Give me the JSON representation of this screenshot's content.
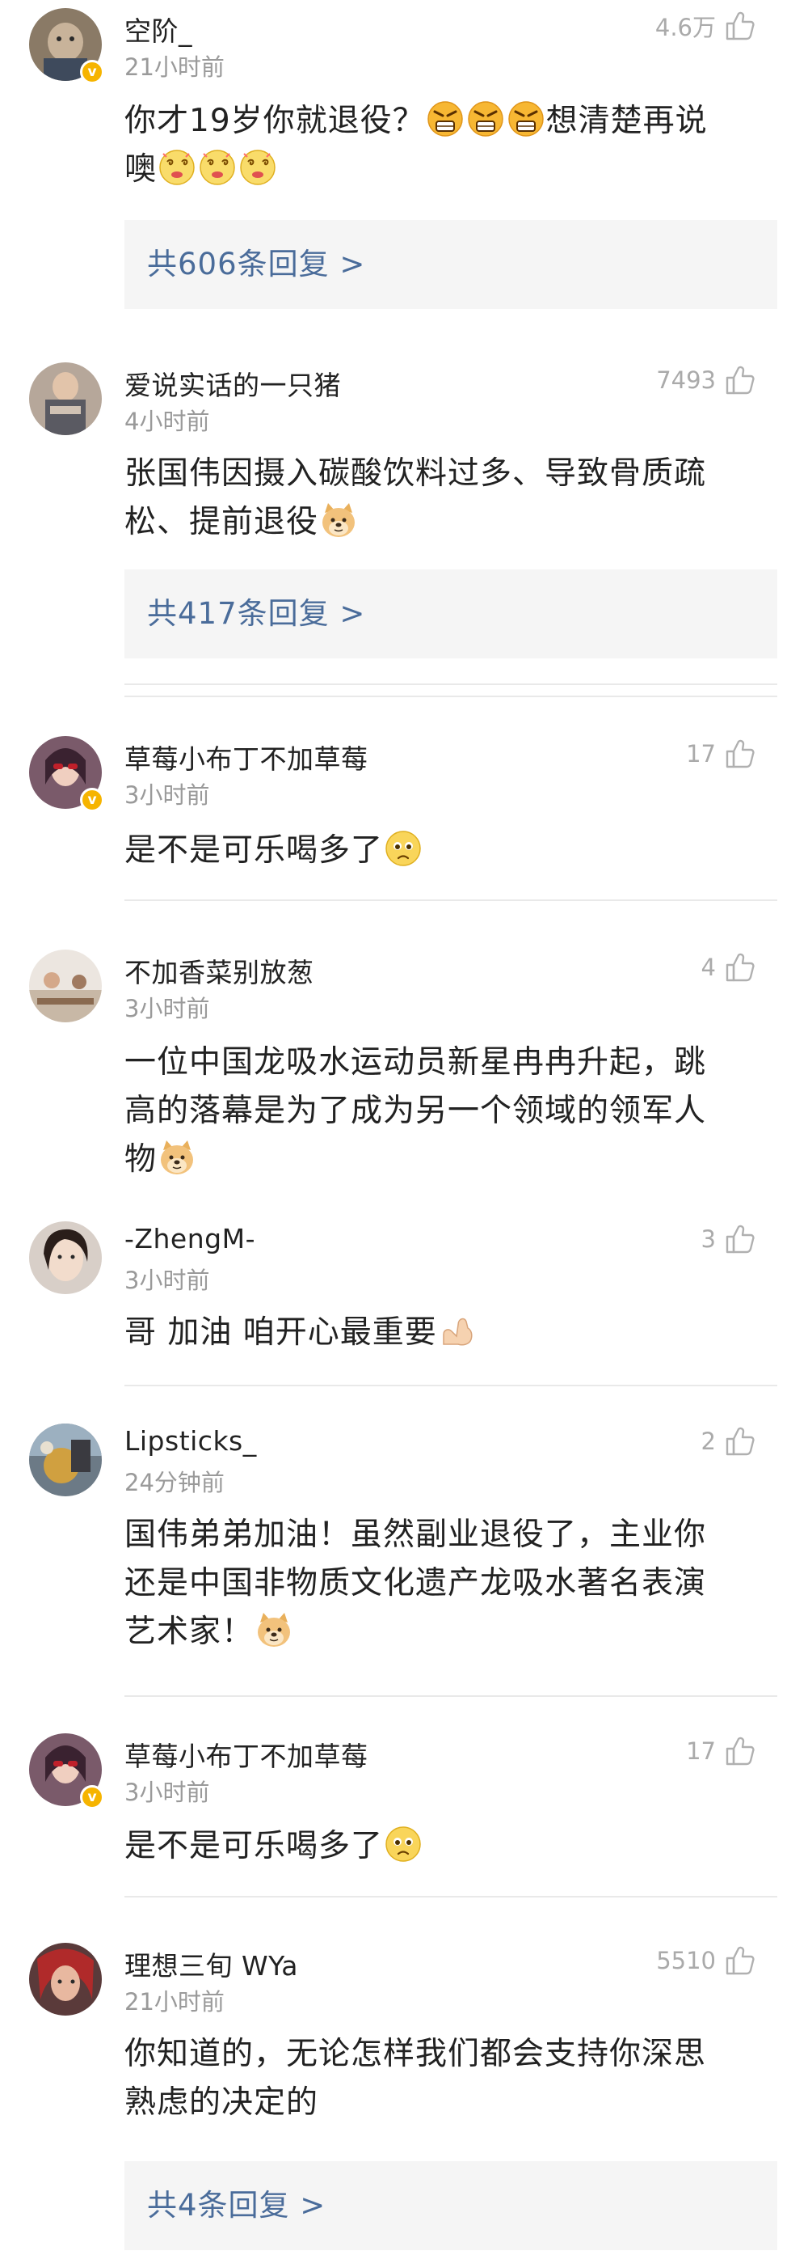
{
  "comments": [
    {
      "username": "空阶_",
      "time": "21小时前",
      "likes": "4.6万",
      "text": "你才19岁你就退役？",
      "text2": "想清楚再说",
      "text3": "噢",
      "replies": "共606条回复 >"
    },
    {
      "username": "爱说实话的一只猪",
      "time": "4小时前",
      "likes": "7493",
      "text": "张国伟因摄入碳酸饮料过多、导致骨质疏",
      "text2": "松、提前退役",
      "replies": "共417条回复 >"
    },
    {
      "username": "草莓小布丁不加草莓",
      "time": "3小时前",
      "likes": "17",
      "text": "是不是可乐喝多了"
    },
    {
      "username": "不加香菜别放葱",
      "time": "3小时前",
      "likes": "4",
      "text": "一位中国龙吸水运动员新星冉冉升起，跳",
      "text2": "高的落幕是为了成为另一个领域的领军人",
      "text3": "物"
    },
    {
      "username": "-ZhengM-",
      "time": "3小时前",
      "likes": "3",
      "text": "哥 加油 咱开心最重要"
    },
    {
      "username": "Lipsticks_",
      "time": "24分钟前",
      "likes": "2",
      "text": "国伟弟弟加油！虽然副业退役了，主业你",
      "text2": "还是中国非物质文化遗产龙吸水著名表演",
      "text3": "艺术家！"
    },
    {
      "username": "草莓小布丁不加草莓",
      "time": "3小时前",
      "likes": "17",
      "text": "是不是可乐喝多了"
    },
    {
      "username": "理想三旬 WYa",
      "time": "21小时前",
      "likes": "5510",
      "text": "你知道的，无论怎样我们都会支持你深思",
      "text2": "熟虑的决定的",
      "replies": "共4条回复 >"
    }
  ],
  "icons": {
    "like": "thumbs-up-icon",
    "verified": "verified-badge-icon",
    "v_mark": "v"
  },
  "colors": {
    "reply_link": "#4a6c9a",
    "verified": "#f6b400",
    "meta": "#9a9a9a"
  }
}
